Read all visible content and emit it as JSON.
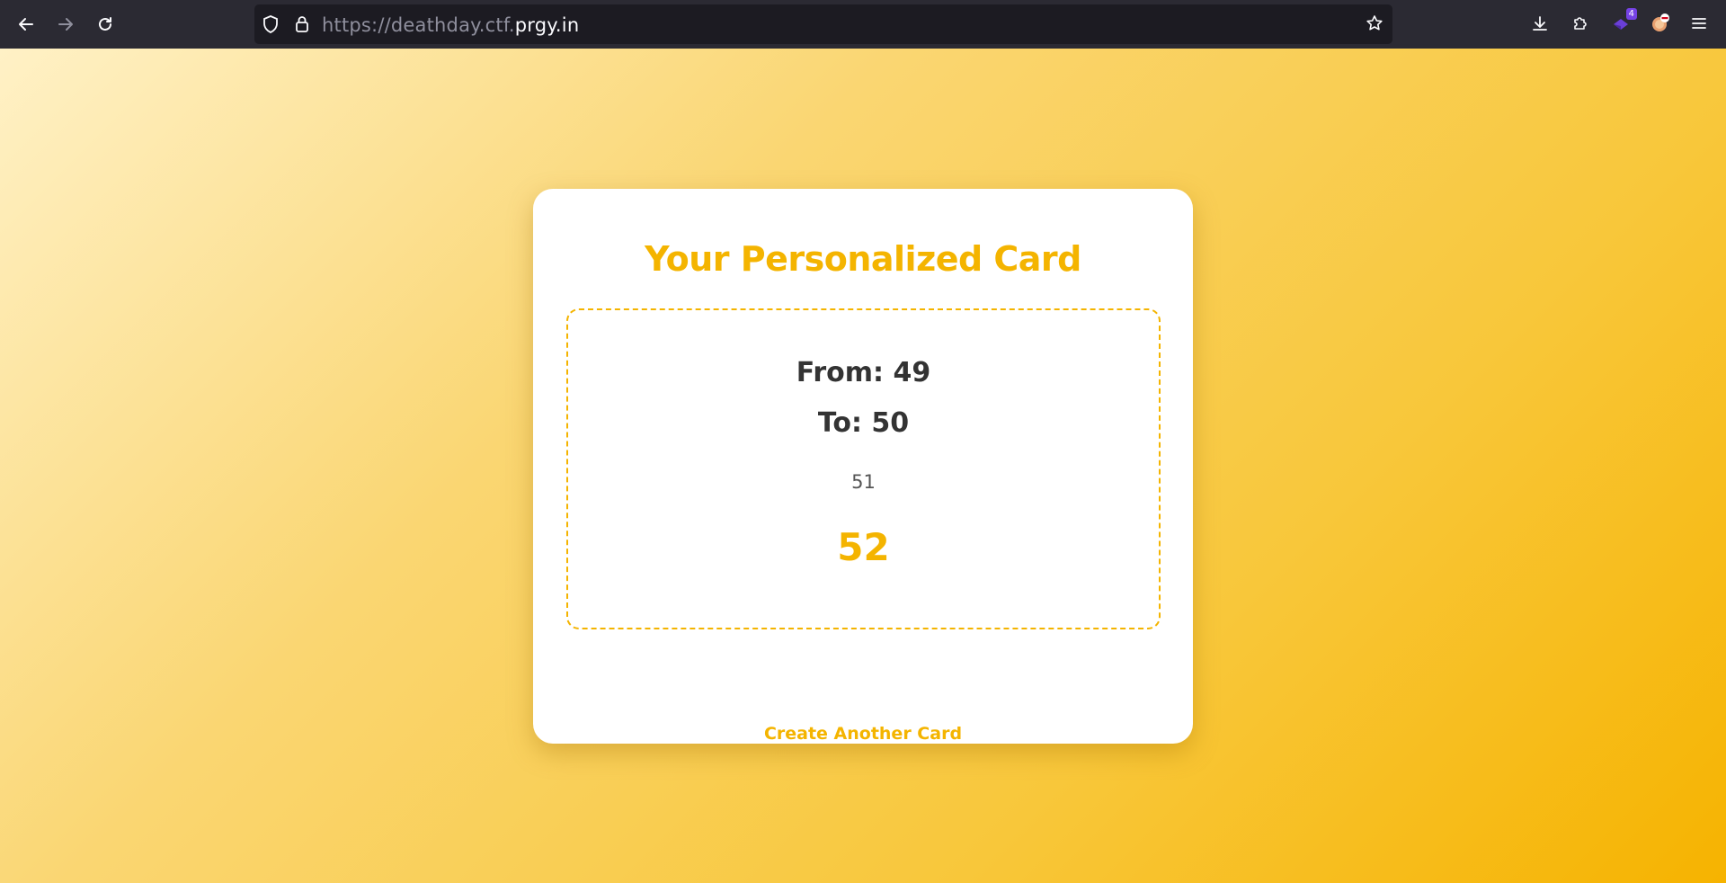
{
  "browser": {
    "url_prefix": "https://deathday.ctf.",
    "url_host": "prgy.in",
    "extension_badge_count": "4",
    "icons": {
      "back": "back-arrow-icon",
      "forward": "forward-arrow-icon",
      "reload": "reload-icon",
      "shield": "shield-icon",
      "lock": "lock-icon",
      "bookmark": "star-icon",
      "downloads": "download-icon",
      "extensions": "puzzle-icon",
      "menu": "hamburger-menu-icon"
    }
  },
  "card": {
    "title": "Your Personalized Card",
    "from": "From: 49",
    "to": "To: 50",
    "message": "51",
    "highlight": "52",
    "create_another": "Create Another Card"
  },
  "colors": {
    "accent": "#f4b400",
    "text_dark": "#333333",
    "toolbar": "#2b2a33"
  }
}
